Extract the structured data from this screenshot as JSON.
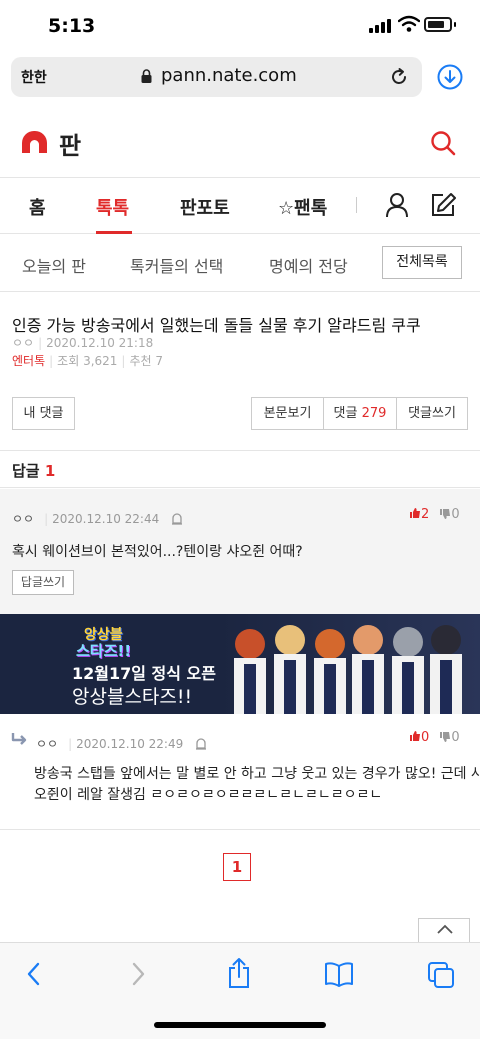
{
  "status": {
    "time": "5:13"
  },
  "browser": {
    "aa_label": "한한",
    "url": "pann.nate.com"
  },
  "header": {
    "logo_text": "판"
  },
  "nav": {
    "tabs": [
      "홈",
      "톡톡",
      "판포토",
      "☆팬톡"
    ],
    "active": "톡톡"
  },
  "subnav": {
    "tabs": [
      "오늘의 판",
      "톡커들의 선택",
      "명예의 전당"
    ],
    "all_list": "전체목록"
  },
  "post": {
    "title": "인증 가능 방송국에서 일했는데 돌들 실물 후기 알랴드림 쿠쿠",
    "author": "ㅇㅇ",
    "datetime": "2020.12.10 21:18",
    "category": "엔터톡",
    "views": "조회 3,621",
    "recommend": "추천 7"
  },
  "buttons": {
    "my_reply": "내 댓글",
    "body_view": "본문보기",
    "reply_label": "댓글",
    "reply_count": "279",
    "write_reply": "댓글쓰기"
  },
  "reply_section": {
    "label": "답글",
    "count": "1"
  },
  "comments": [
    {
      "author": "ㅇㅇ",
      "datetime": "2020.12.10 22:44",
      "likes": "2",
      "dislikes": "0",
      "text": "혹시 웨이션브이 본적있어...?텐이랑 샤오쥔 어때?",
      "reply_button": "답글쓰기"
    },
    {
      "author": "ㅇㅇ",
      "datetime": "2020.12.10 22:49",
      "likes": "0",
      "dislikes": "0",
      "text_line1": "방송국 스탭들 앞에서는 말 별로 안 하고 그냥 웃고 있는 경우가 많오! 근데 샤",
      "text_line2": "오쥔이 레알 잘생김 ㄹㅇㄹㅇㄹㅇㄹㄹㄹㄴㄹㄴㄹㄴㄹㅇㄹㄴ"
    }
  ],
  "banner": {
    "logo_line1": "앙상블",
    "logo_line2": "스타즈!!",
    "date_text": "12월17일 정식 오픈",
    "name_text": "앙상블스타즈!!"
  },
  "pagination": {
    "current": "1"
  },
  "colors": {
    "accent": "#e02a2a",
    "ios_blue": "#1a7cf5"
  }
}
